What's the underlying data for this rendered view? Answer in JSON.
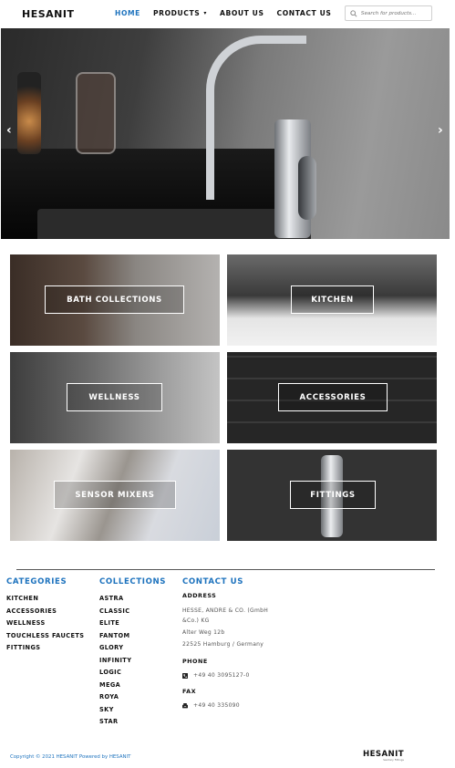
{
  "header": {
    "logo": "HESANIT",
    "nav": [
      {
        "label": "HOME",
        "active": true
      },
      {
        "label": "PRODUCTS",
        "dropdown": true
      },
      {
        "label": "ABOUT US"
      },
      {
        "label": "CONTACT US"
      }
    ],
    "search_placeholder": "Search for products..."
  },
  "hero": {
    "prev_icon": "chevron-left-icon",
    "next_icon": "chevron-right-icon"
  },
  "tiles": [
    {
      "label": "BATH COLLECTIONS"
    },
    {
      "label": "KITCHEN"
    },
    {
      "label": "WELLNESS"
    },
    {
      "label": "ACCESSORIES"
    },
    {
      "label": "SENSOR MIXERS"
    },
    {
      "label": "FITTINGS"
    }
  ],
  "footer": {
    "categories_title": "CATEGORIES",
    "categories": [
      "KITCHEN",
      "ACCESSORIES",
      "WELLNESS",
      "TOUCHLESS FAUCETS",
      "FITTINGS"
    ],
    "collections_title": "COLLECTIONS",
    "collections": [
      "ASTRA",
      "CLASSIC",
      "ELITE",
      "FANTOM",
      "GLORY",
      "INFINITY",
      "LOGIC",
      "MEGA",
      "ROYA",
      "SKY",
      "STAR"
    ],
    "contact_title": "CONTACT US",
    "address_label": "ADDRESS",
    "address_line1": "HESSE, ANDRE & CO. (GmbH",
    "address_line2": "&Co.) KG",
    "address_line3": "Alter Weg 12b",
    "address_line4": "22525 Hamburg / Germany",
    "phone_label": "PHONE",
    "phone": "+49 40 3095127-0",
    "fax_label": "FAX",
    "fax": "+49 40 335090",
    "copyright": "Copyright © 2021 HESANIT Powered by HESANIT",
    "logo": "HESANIT",
    "logo_tag": "Sanitary Fittings"
  },
  "colors": {
    "accent": "#1e73be",
    "text": "#111111"
  }
}
